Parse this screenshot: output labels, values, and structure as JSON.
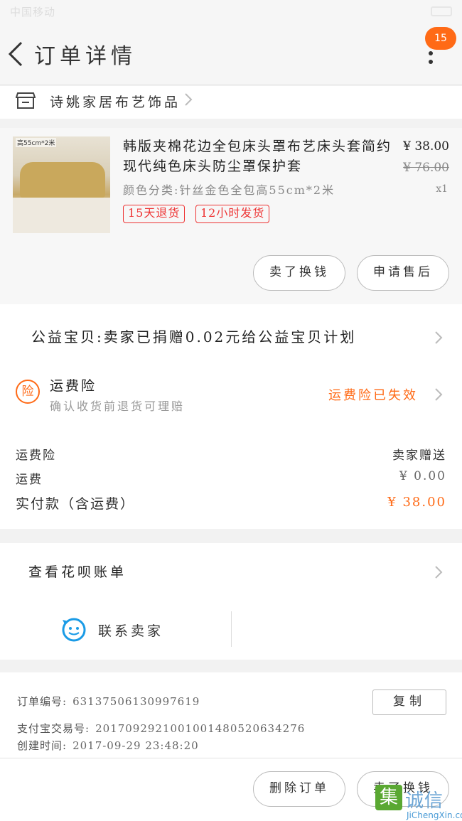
{
  "status_bar": {
    "left_text": "中国移动",
    "time": ""
  },
  "nav": {
    "title": "订单详情",
    "badge_count": "15"
  },
  "shop": {
    "name": "诗姚家居布艺饰品"
  },
  "item": {
    "image_label": "高55cm*2米",
    "name": "韩版夹棉花边全包床头罩布艺床头套简约现代纯色床头防尘罩保护套",
    "sku": "颜色分类:针丝金色全包高55cm*2米",
    "price": "¥ 38.00",
    "original_price": "¥ 76.00",
    "quantity": "x1",
    "tags": [
      "15天退货",
      "12小时发货"
    ],
    "buttons": {
      "sell_change": "卖了换钱",
      "after_sale": "申请售后"
    }
  },
  "charity": {
    "text": "公益宝贝:卖家已捐赠0.02元给公益宝贝计划"
  },
  "insurance": {
    "icon_char": "险",
    "title": "运费险",
    "subtitle": "确认收货前退货可理赔",
    "status": "运费险已失效",
    "status_color": "#ff6a16"
  },
  "costs": {
    "insurance_label": "运费险",
    "insurance_value": "卖家赠送",
    "shipping_label": "运费",
    "shipping_value": "¥ 0.00",
    "paid_label": "实付款（含运费）",
    "paid_value": "¥ 38.00"
  },
  "huabei": {
    "text": "查看花呗账单"
  },
  "contact": {
    "label": "联系卖家"
  },
  "order_info": {
    "order_no_label": "订单编号:",
    "order_no": "63137506130997619",
    "alipay_label": "支付宝交易号:",
    "alipay_no": "2017092921001001480520634276",
    "created_label": "创建时间:",
    "created": "2017-09-29 23:48:20",
    "copy_label": "复制"
  },
  "bottom": {
    "delete_label": "删除订单",
    "sell_change": "卖了换钱"
  },
  "watermark": {
    "logo_char": "集",
    "text": "诚信",
    "url": "JiChengXin.com"
  },
  "colors": {
    "accent": "#ff6a16",
    "tag_red": "#e33333"
  }
}
